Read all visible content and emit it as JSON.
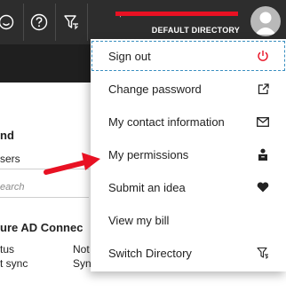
{
  "topbar": {
    "icons": [
      "feedback-smiley-icon",
      "help-question-icon",
      "directory-filter-icon"
    ],
    "account_directory": "DEFAULT DIRECTORY"
  },
  "background": {
    "heading_fragment": "nd",
    "input_fragment": "sers",
    "search_placeholder_fragment": "earch",
    "section_title_fragment": "ure AD Connec",
    "rows": [
      {
        "label": "tus",
        "value": "Not"
      },
      {
        "label": "t sync",
        "value": "Syn"
      }
    ]
  },
  "menu": {
    "items": [
      {
        "label": "Sign out",
        "icon": "power-icon",
        "icon_color": "#e81123"
      },
      {
        "label": "Change password",
        "icon": "external-link-icon"
      },
      {
        "label": "My contact information",
        "icon": "envelope-icon"
      },
      {
        "label": "My permissions",
        "icon": "person-badge-icon"
      },
      {
        "label": "Submit an idea",
        "icon": "heart-icon"
      },
      {
        "label": "View my bill",
        "icon": ""
      },
      {
        "label": "Switch Directory",
        "icon": "directory-filter-icon"
      }
    ]
  },
  "colors": {
    "topbar": "#2d2d2d",
    "subbar": "#1f1f1f",
    "redaction": "#e81123",
    "annotation_arrow": "#e81123"
  }
}
